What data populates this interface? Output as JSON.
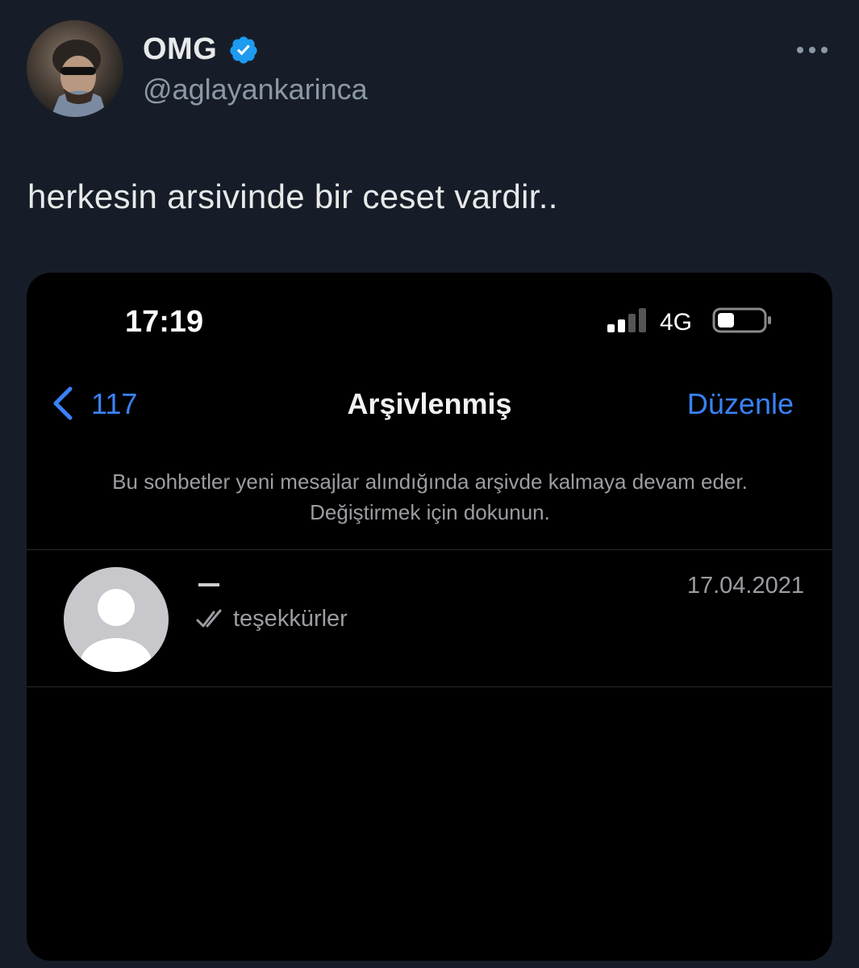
{
  "author": {
    "name": "OMG",
    "handle": "@aglayankarinca"
  },
  "tweet": {
    "text": "herkesin arsivinde bir ceset vardir.."
  },
  "screenshot": {
    "status_bar": {
      "time": "17:19",
      "network": "4G"
    },
    "nav": {
      "back_count": "117",
      "title": "Arşivlenmiş",
      "edit_label": "Düzenle"
    },
    "archive_note": "Bu sohbetler yeni mesajlar alındığında arşivde kalmaya devam eder. Değiştirmek için dokunun.",
    "chats": [
      {
        "preview": "teşekkürler",
        "date": "17.04.2021"
      }
    ]
  },
  "colors": {
    "background": "#171d28",
    "verified": "#1d9bf0",
    "ios_blue": "#3a82f7",
    "text_primary": "#e7e9ea",
    "text_secondary": "#8b98a5"
  },
  "icons": [
    "verified-badge-icon",
    "more-options-icon",
    "signal-icon",
    "battery-icon",
    "chevron-left-icon",
    "double-check-icon",
    "default-avatar-icon"
  ]
}
